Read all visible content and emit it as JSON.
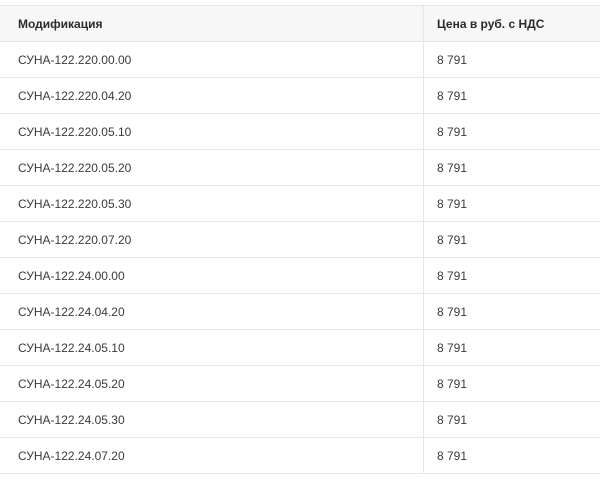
{
  "table": {
    "headers": {
      "modification": "Модификация",
      "price": "Цена в руб. с НДС"
    },
    "rows": [
      {
        "modification": "СУНА-122.220.00.00",
        "price": "8 791"
      },
      {
        "modification": "СУНА-122.220.04.20",
        "price": "8 791"
      },
      {
        "modification": "СУНА-122.220.05.10",
        "price": "8 791"
      },
      {
        "modification": "СУНА-122.220.05.20",
        "price": "8 791"
      },
      {
        "modification": "СУНА-122.220.05.30",
        "price": "8 791"
      },
      {
        "modification": "СУНА-122.220.07.20",
        "price": "8 791"
      },
      {
        "modification": "СУНА-122.24.00.00",
        "price": "8 791"
      },
      {
        "modification": "СУНА-122.24.04.20",
        "price": "8 791"
      },
      {
        "modification": "СУНА-122.24.05.10",
        "price": "8 791"
      },
      {
        "modification": "СУНА-122.24.05.20",
        "price": "8 791"
      },
      {
        "modification": "СУНА-122.24.05.30",
        "price": "8 791"
      },
      {
        "modification": "СУНА-122.24.07.20",
        "price": "8 791"
      }
    ]
  }
}
